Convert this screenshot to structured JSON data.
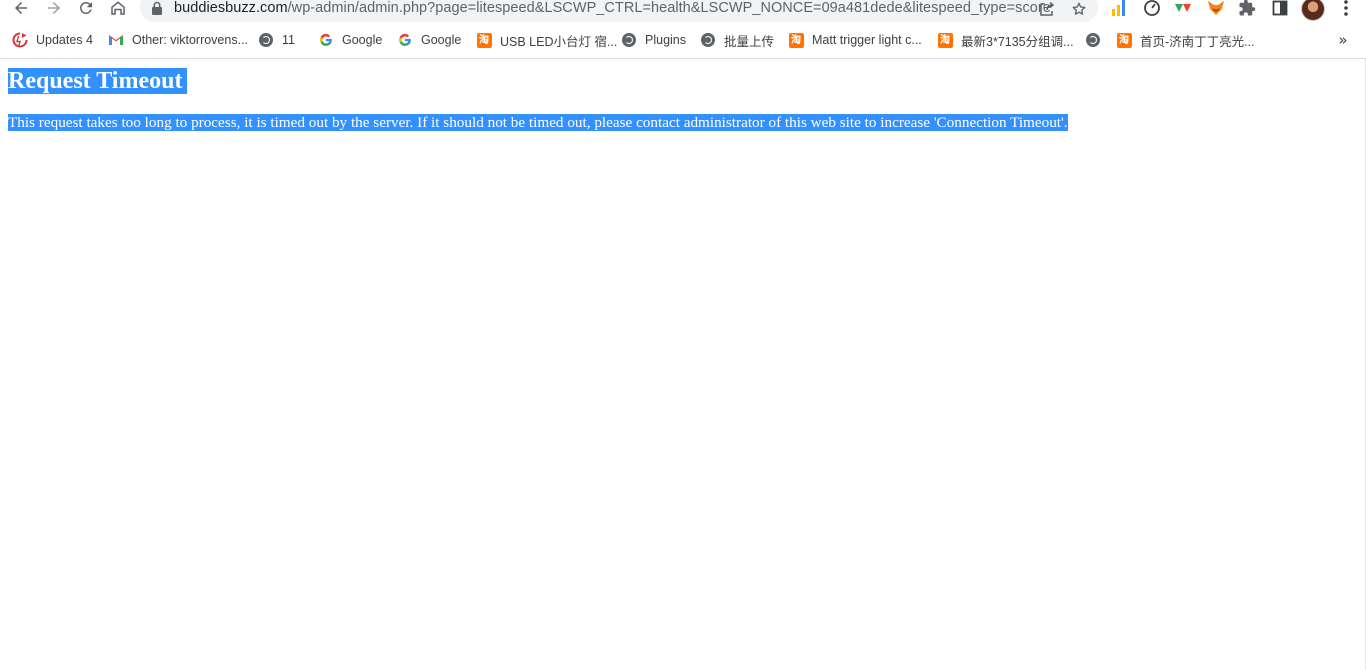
{
  "browser": {
    "url_host": "buddiesbuzz.com",
    "url_path": "/wp-admin/admin.php?page=litespeed&LSCWP_CTRL=health&LSCWP_NONCE=09a481dede&litespeed_type=score",
    "toolbar_icons": [
      "back-icon",
      "forward-icon",
      "reload-icon",
      "home-icon",
      "lock-icon",
      "share-icon",
      "star-icon",
      "chart-extension-icon",
      "speed-extension-icon",
      "triangle-extension-icon",
      "fox-extension-icon",
      "puzzle-icon",
      "side-panel-icon",
      "avatar",
      "more-vert-icon"
    ]
  },
  "bookmarks": [
    {
      "label": "Updates 4",
      "icon": "wordpress-updates-icon"
    },
    {
      "label": "Other: viktorrovens...",
      "icon": "gmail-icon"
    },
    {
      "label": "11",
      "icon": "globe-icon"
    },
    {
      "label": "Google",
      "icon": "google-icon"
    },
    {
      "label": "Google",
      "icon": "google-icon"
    },
    {
      "label": "USB LED小台灯 宿...",
      "icon": "taobao-icon"
    },
    {
      "label": "Plugins",
      "icon": "globe-icon"
    },
    {
      "label": "批量上传",
      "icon": "globe-icon"
    },
    {
      "label": "Matt trigger light c...",
      "icon": "taobao-icon"
    },
    {
      "label": "最新3*7135分组调...",
      "icon": "taobao-icon"
    },
    {
      "label": "",
      "icon": "globe-icon"
    },
    {
      "label": "首页-济南丁丁亮光...",
      "icon": "taobao-icon"
    }
  ],
  "bookmarks_overflow": "»",
  "colors": {
    "selection": "#3390ff",
    "taobao": "#ff7300"
  },
  "page": {
    "heading": "Request Timeout",
    "message": "This request takes too long to process, it is timed out by the server. If it should not be timed out, please contact administrator of this web site to increase 'Connection Timeout'."
  }
}
